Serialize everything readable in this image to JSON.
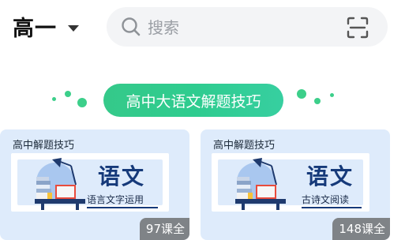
{
  "header": {
    "grade_label": "高一",
    "caret_icon": "caret-down-icon"
  },
  "search": {
    "placeholder": "搜索",
    "value": "",
    "search_icon": "search-icon",
    "scan_icon": "scan-icon"
  },
  "section": {
    "title": "高中大语文解题技巧"
  },
  "colors": {
    "accent": "#2ecc8f",
    "card_bg": "#deebfb",
    "title_blue": "#163a7a"
  },
  "courses": [
    {
      "tag": "高中解题技巧",
      "title": "语文",
      "subtitle": "语言文字运用",
      "count": "97课全"
    },
    {
      "tag": "高中解题技巧",
      "title": "语文",
      "subtitle": "古诗文阅读",
      "count": "148课全"
    }
  ]
}
